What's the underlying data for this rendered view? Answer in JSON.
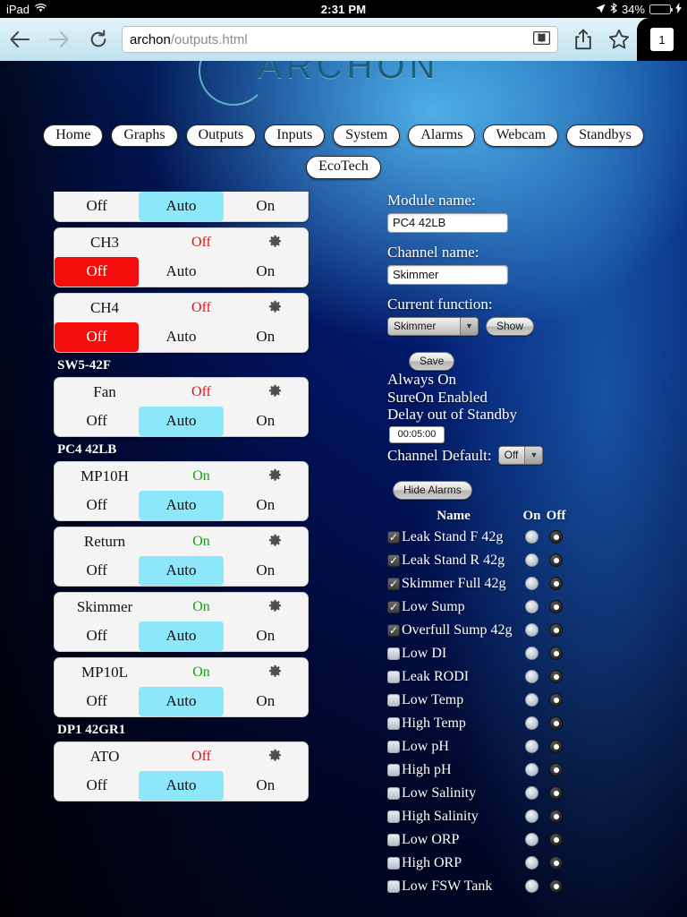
{
  "status_bar": {
    "device": "iPad",
    "wifi_icon": "wifi-icon",
    "time": "2:31 PM",
    "location_icon": "location-arrow-icon",
    "bluetooth_icon": "bluetooth-icon",
    "battery_percent": "34%",
    "battery_level": 34,
    "charging_icon": "lightning-bolt-icon"
  },
  "browser": {
    "back_icon": "back-arrow-icon",
    "forward_icon": "forward-arrow-icon",
    "reload_icon": "reload-icon",
    "url_host": "archon",
    "url_path": "/outputs.html",
    "reader_icon": "reader-view-icon",
    "share_icon": "share-icon",
    "bookmark_icon": "bookmark-star-icon",
    "tab_count": "1"
  },
  "page": {
    "logo_text": "ARCHON",
    "nav_primary": [
      {
        "label": "Home"
      },
      {
        "label": "Graphs"
      },
      {
        "label": "Outputs"
      },
      {
        "label": "Inputs"
      },
      {
        "label": "System"
      },
      {
        "label": "Alarms"
      },
      {
        "label": "Webcam"
      },
      {
        "label": "Standbys"
      }
    ],
    "nav_secondary": [
      {
        "label": "EcoTech"
      }
    ]
  },
  "outputs": {
    "blocks": [
      {
        "group_label": "",
        "channels": [
          {
            "name": "",
            "state": "",
            "state_class": "",
            "partial": true,
            "segments": [
              {
                "label": "Off",
                "selected": false
              },
              {
                "label": "Auto",
                "selected": true
              },
              {
                "label": "On",
                "selected": false
              }
            ]
          },
          {
            "name": "CH3",
            "state": "Off",
            "state_class": "off",
            "partial": false,
            "segments": [
              {
                "label": "Off",
                "selected": true
              },
              {
                "label": "Auto",
                "selected": false
              },
              {
                "label": "On",
                "selected": false
              }
            ]
          },
          {
            "name": "CH4",
            "state": "Off",
            "state_class": "off",
            "partial": false,
            "segments": [
              {
                "label": "Off",
                "selected": true
              },
              {
                "label": "Auto",
                "selected": false
              },
              {
                "label": "On",
                "selected": false
              }
            ]
          }
        ]
      },
      {
        "group_label": "SW5-42F",
        "channels": [
          {
            "name": "Fan",
            "state": "Off",
            "state_class": "off",
            "partial": false,
            "segments": [
              {
                "label": "Off",
                "selected": false
              },
              {
                "label": "Auto",
                "selected": true
              },
              {
                "label": "On",
                "selected": false
              }
            ]
          }
        ]
      },
      {
        "group_label": "PC4 42LB",
        "channels": [
          {
            "name": "MP10H",
            "state": "On",
            "state_class": "on",
            "partial": false,
            "segments": [
              {
                "label": "Off",
                "selected": false
              },
              {
                "label": "Auto",
                "selected": true
              },
              {
                "label": "On",
                "selected": false
              }
            ]
          },
          {
            "name": "Return",
            "state": "On",
            "state_class": "on",
            "partial": false,
            "segments": [
              {
                "label": "Off",
                "selected": false
              },
              {
                "label": "Auto",
                "selected": true
              },
              {
                "label": "On",
                "selected": false
              }
            ]
          },
          {
            "name": "Skimmer",
            "state": "On",
            "state_class": "on",
            "partial": false,
            "segments": [
              {
                "label": "Off",
                "selected": false
              },
              {
                "label": "Auto",
                "selected": true
              },
              {
                "label": "On",
                "selected": false
              }
            ]
          },
          {
            "name": "MP10L",
            "state": "On",
            "state_class": "on",
            "partial": false,
            "segments": [
              {
                "label": "Off",
                "selected": false
              },
              {
                "label": "Auto",
                "selected": true
              },
              {
                "label": "On",
                "selected": false
              }
            ]
          }
        ]
      },
      {
        "group_label": "DP1 42GR1",
        "channels": [
          {
            "name": "ATO",
            "state": "Off",
            "state_class": "off",
            "partial": false,
            "segments": [
              {
                "label": "Off",
                "selected": false
              },
              {
                "label": "Auto",
                "selected": true
              },
              {
                "label": "On",
                "selected": false
              }
            ]
          }
        ]
      }
    ],
    "gear_icon": "gear-icon"
  },
  "detail": {
    "module_name_label": "Module name:",
    "module_name_value": "PC4 42LB",
    "channel_name_label": "Channel name:",
    "channel_name_value": "Skimmer",
    "current_function_label": "Current function:",
    "current_function_value": "Skimmer",
    "show_button": "Show",
    "save_button": "Save",
    "always_on": "Always On",
    "sure_on": "SureOn Enabled",
    "delay_label": "Delay out of Standby",
    "delay_value": "00:05:00",
    "channel_default_label": "Channel Default:",
    "channel_default_value": "Off",
    "hide_alarms_button": "Hide Alarms",
    "dropdown_icon": "chevron-down-icon"
  },
  "alarms": {
    "header": {
      "name": "Name",
      "on": "On",
      "off": "Off"
    },
    "rows": [
      {
        "name": "Leak Stand F 42g",
        "enabled": true,
        "on": false,
        "off": true
      },
      {
        "name": "Leak Stand R 42g",
        "enabled": true,
        "on": false,
        "off": true
      },
      {
        "name": "Skimmer Full 42g",
        "enabled": true,
        "on": false,
        "off": true
      },
      {
        "name": "Low Sump",
        "enabled": true,
        "on": false,
        "off": true
      },
      {
        "name": "Overfull Sump 42g",
        "enabled": true,
        "on": false,
        "off": true
      },
      {
        "name": "Low DI",
        "enabled": false,
        "on": false,
        "off": true
      },
      {
        "name": "Leak RODI",
        "enabled": false,
        "on": false,
        "off": true
      },
      {
        "name": "Low Temp",
        "enabled": false,
        "on": false,
        "off": true
      },
      {
        "name": "High Temp",
        "enabled": false,
        "on": false,
        "off": true
      },
      {
        "name": "Low pH",
        "enabled": false,
        "on": false,
        "off": true
      },
      {
        "name": "High pH",
        "enabled": false,
        "on": false,
        "off": true
      },
      {
        "name": "Low Salinity",
        "enabled": false,
        "on": false,
        "off": true
      },
      {
        "name": "High Salinity",
        "enabled": false,
        "on": false,
        "off": true
      },
      {
        "name": "Low ORP",
        "enabled": false,
        "on": false,
        "off": true
      },
      {
        "name": "High ORP",
        "enabled": false,
        "on": false,
        "off": true
      },
      {
        "name": "Low FSW Tank",
        "enabled": false,
        "on": false,
        "off": true
      }
    ]
  },
  "colors": {
    "selected_auto": "#8ce7fb",
    "selected_off": "#f40d0d",
    "state_on": "#18a118",
    "state_off": "#e01414",
    "battery": "#4cd964"
  }
}
